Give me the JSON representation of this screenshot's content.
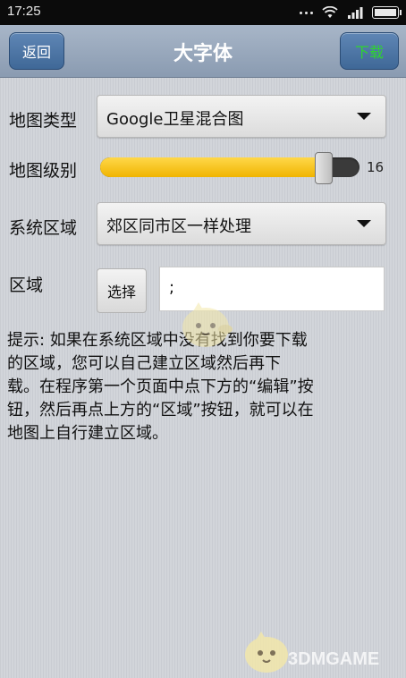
{
  "status_bar": {
    "time": "17:25"
  },
  "header": {
    "back_label": "返回",
    "title": "大字体",
    "download_label": "下载",
    "download_color": "#2fd42f"
  },
  "form": {
    "map_type": {
      "label": "地图类型",
      "value": "Google卫星混合图"
    },
    "map_level": {
      "label": "地图级别",
      "value": "16",
      "fill_fraction": 0.86
    },
    "system_region": {
      "label": "系统区域",
      "value": "郊区同市区一样处理"
    },
    "region": {
      "label": "区域",
      "select_label": "选择",
      "input_value": ";"
    }
  },
  "hint": "提示: 如果在系统区域中没有找到你要下载\n的区域，您可以自己建立区域然后再下\n载。在程序第一个页面中点下方的“编辑”按\n钮，然后再点上方的“区域”按钮，就可以在\n地图上自行建立区域。",
  "watermark": "3DMGAME"
}
